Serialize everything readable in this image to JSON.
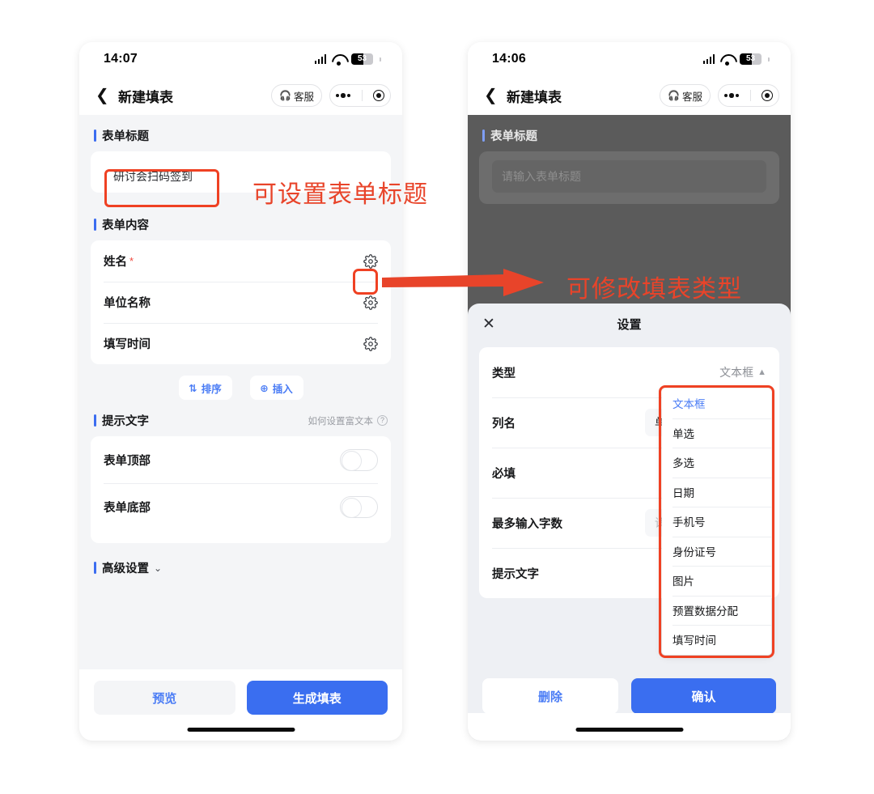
{
  "annotations": {
    "title_hint": "可设置表单标题",
    "type_hint": "可修改填表类型"
  },
  "left_phone": {
    "status": {
      "time": "14:07",
      "battery": "53",
      "signal_icon": "cellular-bars-icon",
      "wifi_icon": "wifi-icon",
      "battery_icon": "battery-icon"
    },
    "nav": {
      "back_icon": "chevron-left-icon",
      "title": "新建填表",
      "support_label": "客服",
      "support_icon": "headphone-icon",
      "more_icon": "more-dots-icon",
      "target_icon": "target-circle-icon"
    },
    "form_title_section": {
      "heading": "表单标题",
      "value": "研讨会扫码签到"
    },
    "form_content_section": {
      "heading": "表单内容",
      "fields": [
        {
          "label": "姓名",
          "required": "*",
          "gear_icon": "gear-icon"
        },
        {
          "label": "单位名称",
          "required": "",
          "gear_icon": "gear-icon"
        },
        {
          "label": "填写时间",
          "required": "",
          "gear_icon": "gear-icon"
        }
      ],
      "sort_label": "排序",
      "sort_icon": "sort-arrows-icon",
      "insert_label": "插入",
      "insert_icon": "plus-circle-icon"
    },
    "hint_text_section": {
      "heading": "提示文字",
      "help_label": "如何设置富文本",
      "help_icon": "question-circle-icon",
      "rows": [
        {
          "label": "表单顶部",
          "toggle": "off"
        },
        {
          "label": "表单底部",
          "toggle": "off"
        }
      ]
    },
    "advanced_section": {
      "heading": "高级设置",
      "chevron_icon": "chevron-down-icon"
    },
    "footer": {
      "preview_label": "预览",
      "generate_label": "生成填表"
    }
  },
  "right_phone": {
    "status": {
      "time": "14:06",
      "battery": "53",
      "signal_icon": "cellular-bars-icon",
      "wifi_icon": "wifi-icon",
      "battery_icon": "battery-icon"
    },
    "nav": {
      "back_icon": "chevron-left-icon",
      "title": "新建填表",
      "support_label": "客服",
      "support_icon": "headphone-icon",
      "more_icon": "more-dots-icon",
      "target_icon": "target-circle-icon"
    },
    "background": {
      "heading": "表单标题",
      "input_placeholder": "请输入表单标题"
    },
    "sheet": {
      "close_icon": "close-x-icon",
      "title": "设置",
      "rows": [
        {
          "label": "类型",
          "value": "文本框",
          "chevron_icon": "chevron-up-icon"
        },
        {
          "label": "列名",
          "value": "单位名称"
        },
        {
          "label": "必填",
          "value": ""
        },
        {
          "label": "最多输入字数",
          "value": "请输入"
        },
        {
          "label": "提示文字",
          "value": ""
        }
      ],
      "dropdown": {
        "selected": "文本框",
        "options": [
          "文本框",
          "单选",
          "多选",
          "日期",
          "手机号",
          "身份证号",
          "图片",
          "预置数据分配",
          "填写时间"
        ]
      },
      "footer": {
        "delete_label": "删除",
        "confirm_label": "确认"
      }
    }
  },
  "colors": {
    "accent_blue": "#3a6ef0",
    "annotation_red": "#e8442a",
    "highlight_red": "#ef4123",
    "required_red": "#f0493e"
  }
}
